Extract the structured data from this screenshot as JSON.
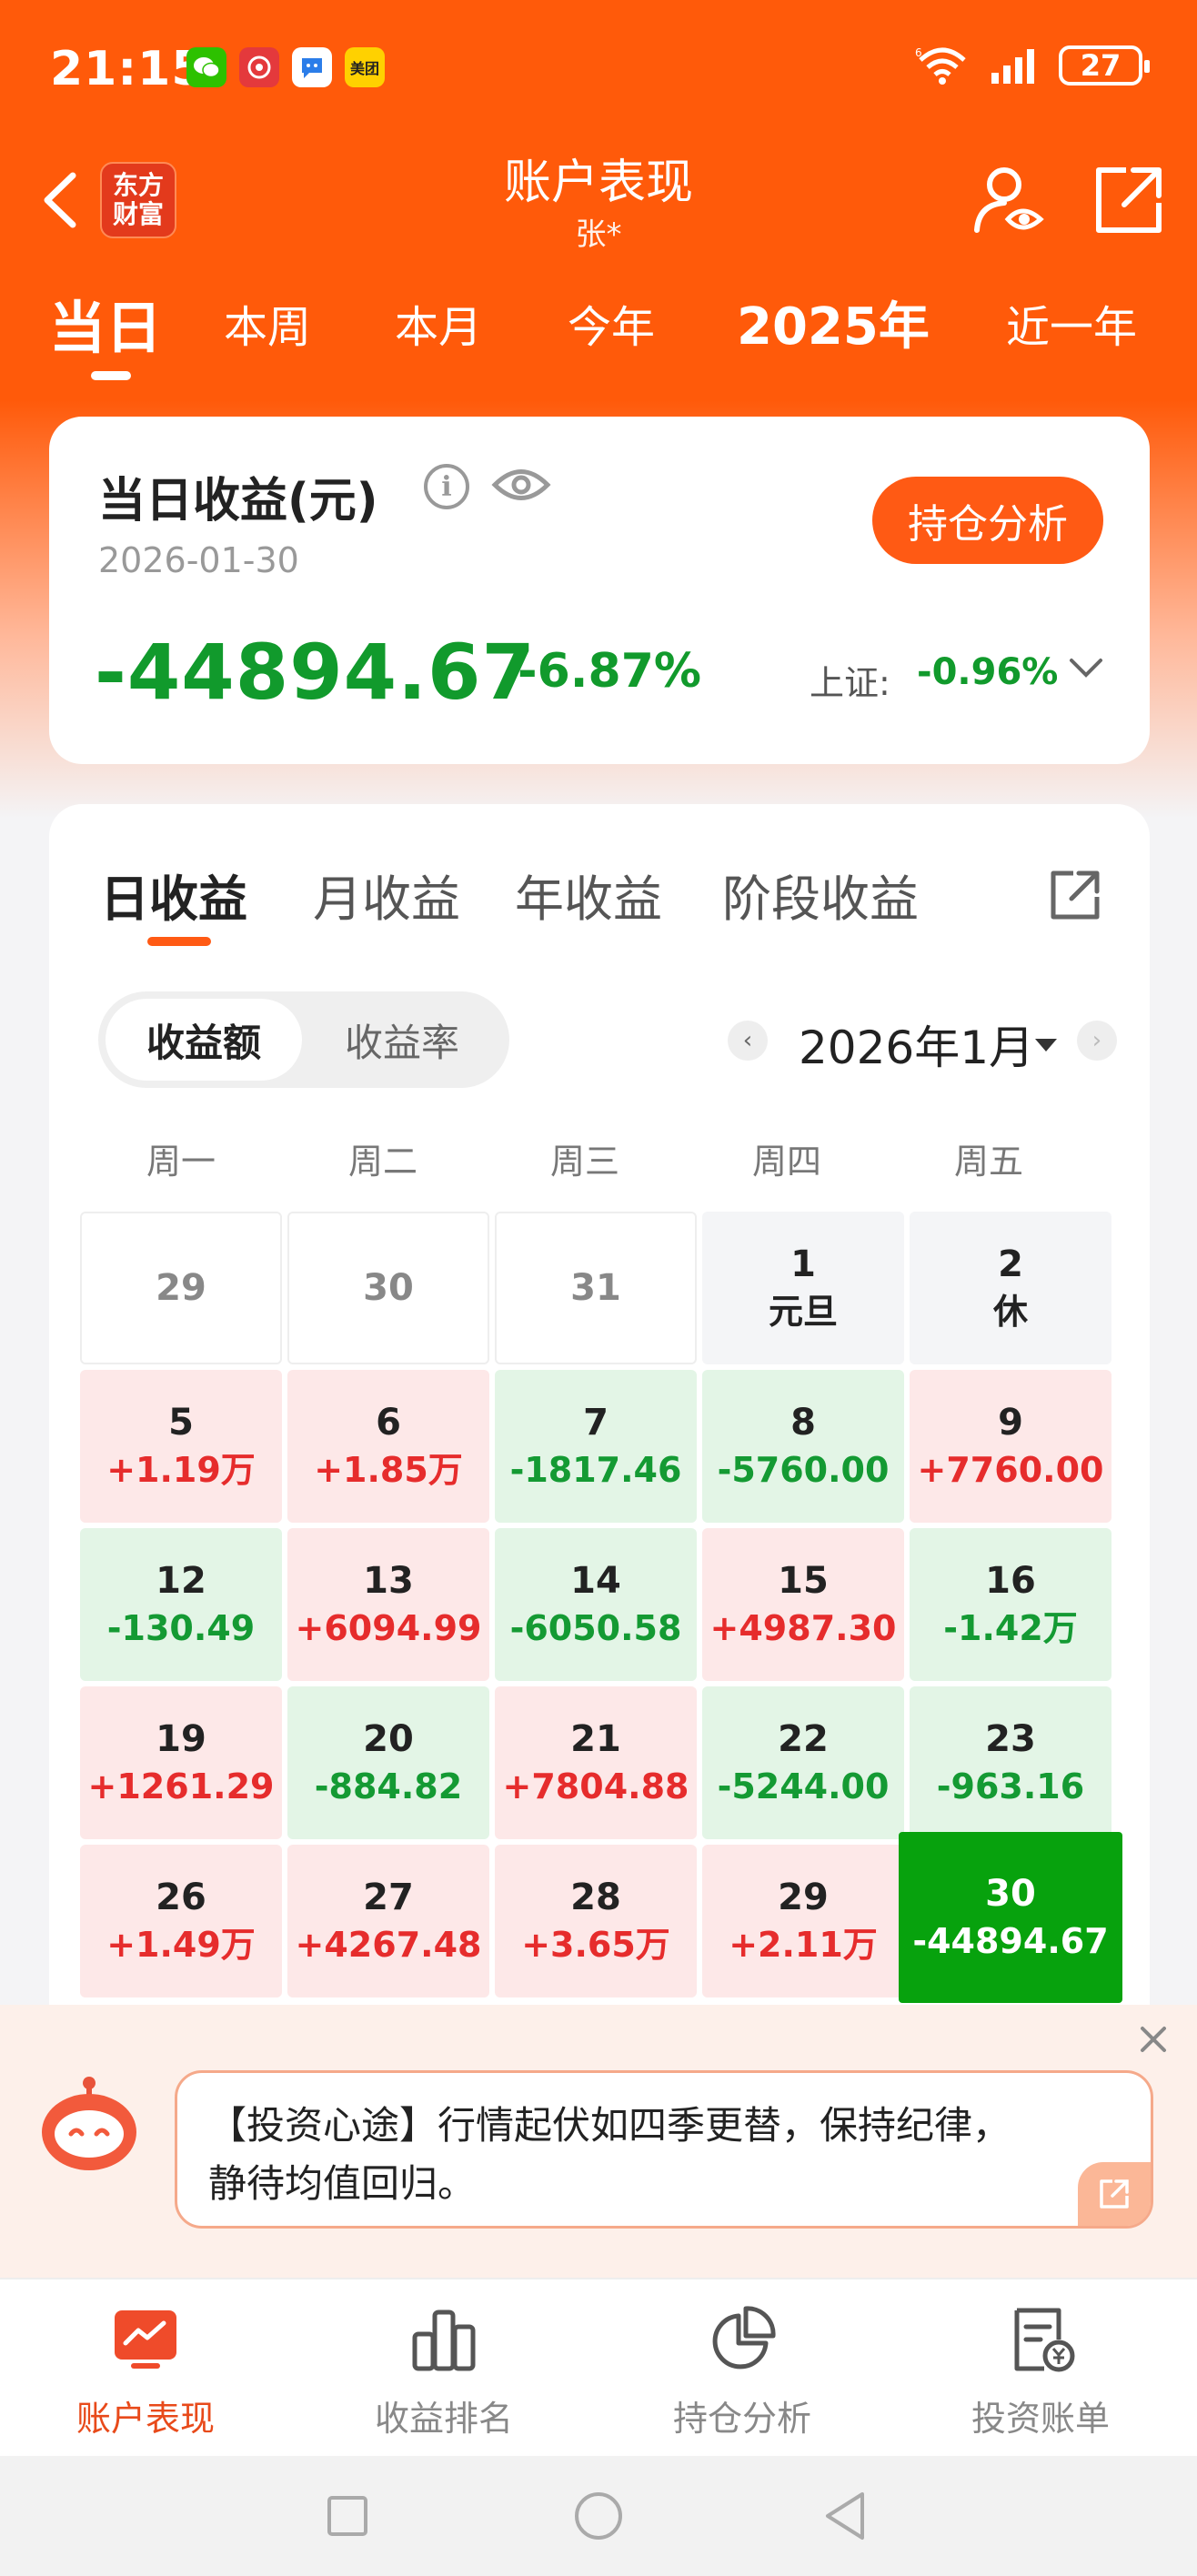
{
  "status": {
    "time": "21:15",
    "battery": "27",
    "apps": [
      {
        "name": "wechat-icon",
        "color": "#2dc100"
      },
      {
        "name": "music-app-icon",
        "color": "#e4393c"
      },
      {
        "name": "chat-bubble-app-icon",
        "color": "#2b7de9"
      },
      {
        "name": "meituan-icon",
        "color": "#ffd100",
        "label": "美团"
      }
    ]
  },
  "nav": {
    "logo_line1": "东方",
    "logo_line2": "财富",
    "title": "账户表现",
    "subtitle": "张*"
  },
  "periods": [
    {
      "label": "当日",
      "active": true
    },
    {
      "label": "本周"
    },
    {
      "label": "本月"
    },
    {
      "label": "今年"
    },
    {
      "label": "2025年"
    },
    {
      "label": "近一年"
    }
  ],
  "summary": {
    "title": "当日收益(元)",
    "info_glyph": "i",
    "date": "2026-01-30",
    "button": "持仓分析",
    "amount": "-44894.67",
    "percent": "-6.87%",
    "index_label": "上证:",
    "index_value": "-0.96%"
  },
  "calendar": {
    "tabs": [
      "日收益",
      "月收益",
      "年收益",
      "阶段收益"
    ],
    "toggle": [
      "收益额",
      "收益率"
    ],
    "month_label": "2026年1月",
    "prev_glyph": "‹",
    "next_glyph": "›",
    "weekdays": [
      "周一",
      "周二",
      "周三",
      "周四",
      "周五"
    ],
    "rows": [
      [
        {
          "d": "29",
          "v": "",
          "kind": "empty"
        },
        {
          "d": "30",
          "v": "",
          "kind": "empty"
        },
        {
          "d": "31",
          "v": "",
          "kind": "empty"
        },
        {
          "d": "1",
          "v": "元旦",
          "kind": "holiday"
        },
        {
          "d": "2",
          "v": "休",
          "kind": "holiday"
        }
      ],
      [
        {
          "d": "5",
          "v": "+1.19万",
          "kind": "up"
        },
        {
          "d": "6",
          "v": "+1.85万",
          "kind": "up"
        },
        {
          "d": "7",
          "v": "-1817.46",
          "kind": "down"
        },
        {
          "d": "8",
          "v": "-5760.00",
          "kind": "down"
        },
        {
          "d": "9",
          "v": "+7760.00",
          "kind": "up"
        }
      ],
      [
        {
          "d": "12",
          "v": "-130.49",
          "kind": "down"
        },
        {
          "d": "13",
          "v": "+6094.99",
          "kind": "up"
        },
        {
          "d": "14",
          "v": "-6050.58",
          "kind": "down"
        },
        {
          "d": "15",
          "v": "+4987.30",
          "kind": "up"
        },
        {
          "d": "16",
          "v": "-1.42万",
          "kind": "down"
        }
      ],
      [
        {
          "d": "19",
          "v": "+1261.29",
          "kind": "up"
        },
        {
          "d": "20",
          "v": "-884.82",
          "kind": "down"
        },
        {
          "d": "21",
          "v": "+7804.88",
          "kind": "up"
        },
        {
          "d": "22",
          "v": "-5244.00",
          "kind": "down"
        },
        {
          "d": "23",
          "v": "-963.16",
          "kind": "down"
        }
      ],
      [
        {
          "d": "26",
          "v": "+1.49万",
          "kind": "up"
        },
        {
          "d": "27",
          "v": "+4267.48",
          "kind": "up"
        },
        {
          "d": "28",
          "v": "+3.65万",
          "kind": "up"
        },
        {
          "d": "29",
          "v": "+2.11万",
          "kind": "up"
        },
        {
          "d": "30",
          "v": "-44894.67",
          "kind": "selected"
        }
      ]
    ]
  },
  "tip": {
    "text": "【投资心途】行情起伏如四季更替，保持纪律，静待均值回归。"
  },
  "bottom_nav": [
    {
      "label": "账户表现",
      "icon": "account-performance-icon",
      "active": true
    },
    {
      "label": "收益排名",
      "icon": "ranking-bars-icon"
    },
    {
      "label": "持仓分析",
      "icon": "pie-chart-icon"
    },
    {
      "label": "投资账单",
      "icon": "bill-icon"
    }
  ],
  "colors": {
    "brand": "#ff5a0a",
    "up": "#e62c2c",
    "down": "#119a2c",
    "selected": "#07a20d"
  }
}
